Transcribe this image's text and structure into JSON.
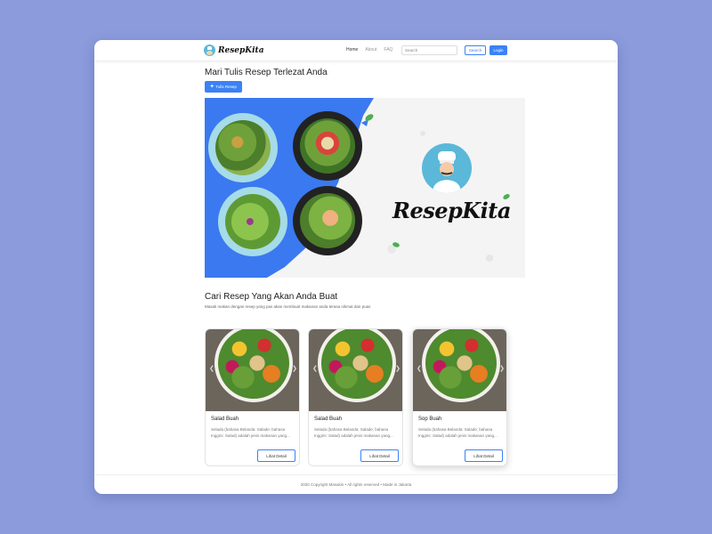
{
  "navbar": {
    "brand": "ResepKita",
    "links": [
      {
        "label": "Home",
        "active": true
      },
      {
        "label": "About",
        "active": false
      },
      {
        "label": "FAQ",
        "active": false
      }
    ],
    "search_placeholder": "Search",
    "search_button": "Search",
    "login_button": "Login"
  },
  "hero": {
    "title": "Mari Tulis Resep Terlezat Anda",
    "write_button": "Tulis Resep",
    "banner_brand": "ResepKita"
  },
  "recipes_section": {
    "title": "Cari Resep Yang Akan Anda Buat",
    "subtitle": "Masak makan dengan resep yang pas akan membuat makanan anda terasa nikmat dan puas"
  },
  "cards": [
    {
      "title": "Salad Buah",
      "description": "Selada (bahasa Belanda: Salade; bahasa Inggris: Salad) adalah jenis makanan yang...",
      "button": "Lihat Detail"
    },
    {
      "title": "Salad Buah",
      "description": "Selada (bahasa Belanda: Salade; bahasa Inggris: Salad) adalah jenis makanan yang...",
      "button": "Lihat Detail"
    },
    {
      "title": "Sop Buah",
      "description": "Selada (bahasa Belanda: Salade; bahasa Inggris: Salad) adalah jenis makanan yang...",
      "button": "Lihat Detail"
    }
  ],
  "footer": {
    "text": "2020 Copyright Masakin • All rights reserved • Made in Jakarta"
  },
  "colors": {
    "page_background": "#8b9bdc",
    "accent": "#3b82f6",
    "logo": "#5bb8d9"
  },
  "icons": [
    "chef-logo-icon",
    "plus-icon",
    "chevron-left-icon",
    "chevron-right-icon"
  ]
}
